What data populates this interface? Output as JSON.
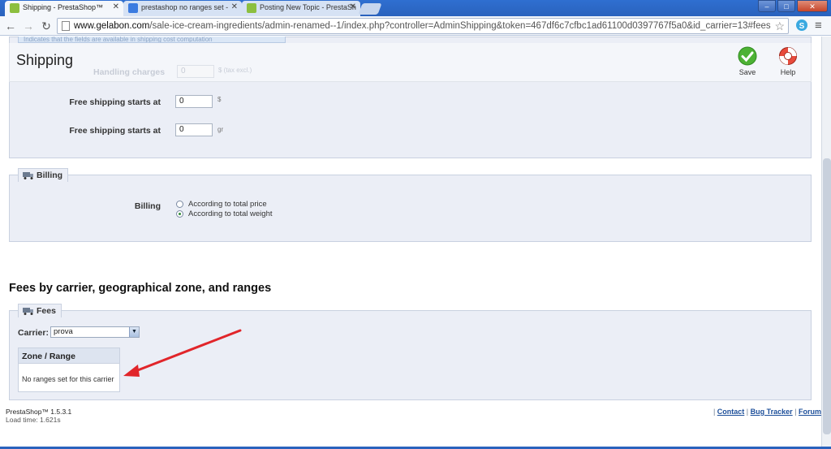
{
  "browser": {
    "tabs": [
      {
        "title": "Shipping - PrestaShop™",
        "favicon_color": "#8cbf3f",
        "close": "✕"
      },
      {
        "title": "prestashop no ranges set - ",
        "favicon_color": "#3b7be0",
        "close": "✕"
      },
      {
        "title": "Posting New Topic - PrestaSh",
        "favicon_color": "#8cbf3f",
        "close": "✕"
      }
    ],
    "window_buttons": {
      "minimize": "–",
      "maximize": "□",
      "close": "✕"
    },
    "address": {
      "domain": "www.gelabon.com",
      "path": "/sale-ice-cream-ingredients/admin-renamed--1/index.php?controller=AdminShipping&token=467df6c7cfbc1ad61100d0397767f5a0&id_carrier=13#fees"
    },
    "nav": {
      "back": "←",
      "forward": "→",
      "reload": "↻",
      "star": "☆",
      "menu": "≡"
    }
  },
  "page": {
    "hint_text": "Indicates that the fields are available in shipping cost computation",
    "title": "Shipping",
    "ghost_label": "Handling charges",
    "ghost_value": "0",
    "ghost_unit": "$ (tax excl.)",
    "toolbar": {
      "save_label": "Save",
      "help_label": "Help"
    },
    "free_shipping": [
      {
        "label": "Free shipping starts at",
        "value": "0",
        "unit": "$"
      },
      {
        "label": "Free shipping starts at",
        "value": "0",
        "unit": "gr"
      }
    ],
    "billing": {
      "legend": "Billing",
      "label": "Billing",
      "options": [
        {
          "label": "According to total price",
          "checked": false
        },
        {
          "label": "According to total weight",
          "checked": true
        }
      ]
    },
    "fees_heading": "Fees by carrier, geographical zone, and ranges",
    "fees": {
      "legend": "Fees",
      "carrier_label": "Carrier:",
      "carrier_selected": "prova",
      "table_header": "Zone / Range",
      "empty_message": "No ranges set for this carrier"
    },
    "footer": {
      "version": "PrestaShop™ 1.5.3.1",
      "load_time": "Load time: 1.621s",
      "links": [
        "Contact",
        "Bug Tracker",
        "Forum"
      ]
    },
    "colors": {
      "accent_red": "#e1252a",
      "panel_bg": "#ebeef6",
      "link": "#1d4f9a"
    }
  }
}
